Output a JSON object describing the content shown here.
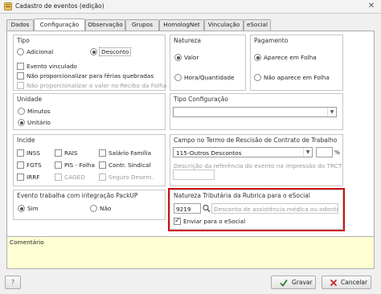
{
  "window": {
    "title": "Cadastro de eventos (edição)",
    "close": "✕"
  },
  "tabs": [
    "Dados",
    "Configuração",
    "Observação",
    "Grupos",
    "HomologNet",
    "Vinculação",
    "eSocial"
  ],
  "tipo": {
    "title": "Tipo",
    "adicional": "Adicional",
    "desconto": "Desconto",
    "evento_vinculado": "Evento vinculado",
    "nao_prop_ferias": "Não proporcionalizar para férias quebradas",
    "nao_prop_recibo": "Não proporcionalizar o valor no Recibo da Folha"
  },
  "natureza": {
    "title": "Natureza",
    "valor": "Valor",
    "hora": "Hora/Quantidade"
  },
  "pagamento": {
    "title": "Pagamento",
    "aparece": "Aparece em Folha",
    "nao_aparece": "Não aparece em Folha"
  },
  "unidade": {
    "title": "Unidade",
    "minutos": "Minutos",
    "unitario": "Unitário"
  },
  "tipo_config": {
    "title": "Tipo Configuração",
    "value": ""
  },
  "incide": {
    "title": "Incide",
    "inss": "INSS",
    "rais": "RAIS",
    "salario_familia": "Salário Família",
    "fgts": "FGTS",
    "pis_folha": "PIS - Folha",
    "contr_sindical": "Contr. Sindical",
    "irrf": "IRRF",
    "caged": "CAGED",
    "seguro_desem": "Seguro Desem."
  },
  "trct": {
    "title": "Campo no Termo de Rescisão de Contrato de Trabalho",
    "selected": "115-Outros Descontos",
    "percent_label": "%",
    "desc_placeholder": "Descrição da referência do evento na impressão do TRCT"
  },
  "packup": {
    "title": "Evento trabalha com integração PackUP",
    "sim": "Sim",
    "nao": "Não"
  },
  "natureza_trib": {
    "title": "Natureza Tributária da Rubrica para o eSocial",
    "code": "9219",
    "desc_placeholder": "Desconto de assistência médica ou odontológica",
    "enviar": "Enviar para o eSocial"
  },
  "comentario": {
    "title": "Comentário"
  },
  "buttons": {
    "help": "?",
    "gravar": "Gravar",
    "cancelar": "Cancelar"
  },
  "colors": {
    "highlight_border": "#d01010",
    "comment_bg": "#ffffd4"
  }
}
